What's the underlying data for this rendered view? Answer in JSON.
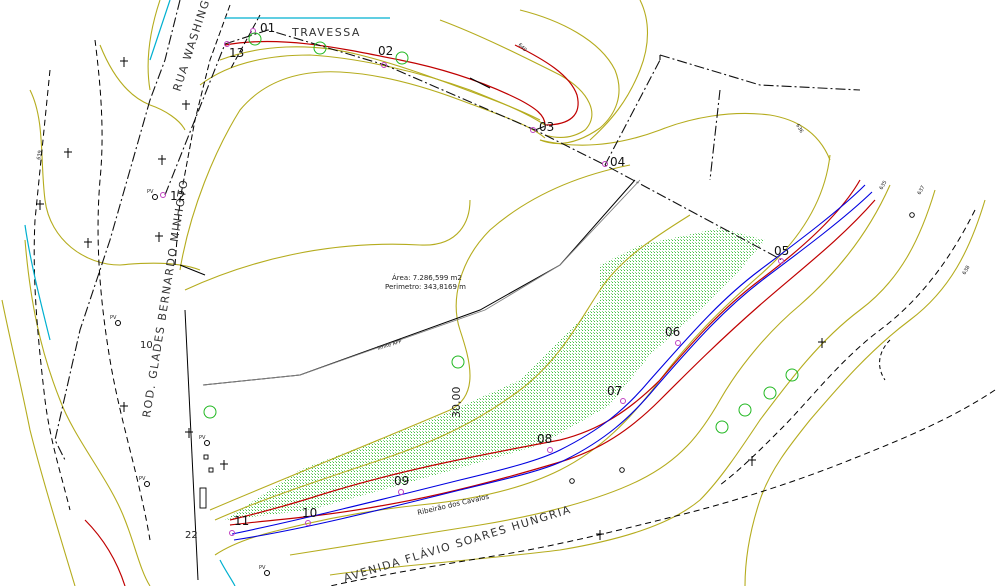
{
  "streets": {
    "travessa": "TRAVESSA",
    "rua_washington": "RUA WASHINGTON",
    "rodovia": "ROD. GLADES BERNARDO MINHOTO",
    "avenida": "AVENIDA FLÁVIO SOARES HUNGRIA"
  },
  "area_info": {
    "area_line": "Área: 7.286,599 m2",
    "perimeter_line": "Perimetro: 343,8169 m"
  },
  "labels": {
    "river": "Ribeirão dos Cavalos",
    "app_limit": "limite APP",
    "app_width": "30,00",
    "pv": "PV"
  },
  "vertices": [
    "01",
    "02",
    "03",
    "04",
    "05",
    "06",
    "07",
    "08",
    "09",
    "10",
    "11",
    "12",
    "13"
  ],
  "contours": {
    "c640": "640",
    "c635": "635",
    "c636": "636",
    "c637": "637",
    "c638": "638",
    "c639": "639",
    "y10": "10",
    "y22": "22"
  },
  "colors": {
    "property_line": "#111111",
    "contour": "#a8a21a",
    "contour_major": "#c00000",
    "river": "#0000e0",
    "vertex": "#c040c0",
    "vegetation": "#22b822",
    "road": "#000000"
  }
}
